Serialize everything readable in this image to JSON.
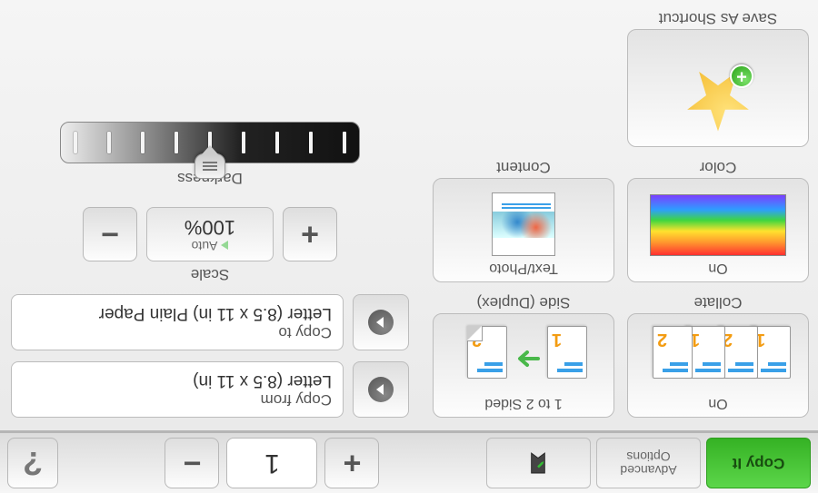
{
  "toolbar": {
    "copy_it": "Copy It",
    "advanced_line1": "Advanced",
    "advanced_line2": "Options",
    "copies_value": "1",
    "help": "?"
  },
  "tiles": {
    "collate": {
      "caption": "Collate",
      "value": "On"
    },
    "side": {
      "caption": "Side (Duplex)",
      "value": "1 to 2 Sided"
    },
    "color": {
      "caption": "Color",
      "value": "On"
    },
    "content": {
      "caption": "Content",
      "value": "Text/Photo"
    },
    "shortcut": {
      "caption": "Save As Shortcut"
    }
  },
  "fields": {
    "copy_from": {
      "label": "Copy from",
      "value": "Letter (8.5 x 11 in)"
    },
    "copy_to": {
      "label": "Copy to",
      "value": "Letter (8.5 x 11 in) Plain Paper"
    }
  },
  "scale": {
    "caption": "Scale",
    "auto": "Auto",
    "value": "100%"
  },
  "darkness": {
    "caption": "Darkness",
    "level": 5,
    "max": 9
  }
}
